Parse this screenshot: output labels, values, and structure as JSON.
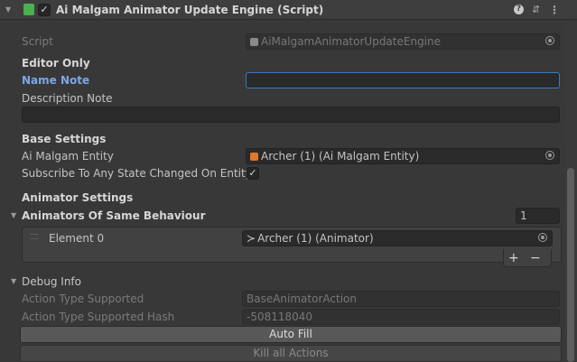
{
  "header": {
    "title": "Ai Malgam Animator Update Engine (Script)",
    "icons": [
      "foldout-triangle-icon",
      "script-icon",
      "checkbox-check-icon",
      "help-icon",
      "preset-icon",
      "kebab-menu-icon"
    ]
  },
  "script_row": {
    "label": "Script",
    "value": "AiMalgamAnimatorUpdateEngine"
  },
  "editor_only": {
    "heading": "Editor Only",
    "name_note_label": "Name Note",
    "name_note_value": "",
    "description_label": "Description Note",
    "description_value": ""
  },
  "base_settings": {
    "heading": "Base Settings",
    "entity_label": "Ai Malgam Entity",
    "entity_value": "Archer (1) (Ai Malgam Entity)",
    "subscribe_label": "Subscribe To Any State Changed On Entity",
    "subscribe_checked": "✓"
  },
  "animator_settings": {
    "heading": "Animator Settings",
    "list_label": "Animators Of Same Behaviour",
    "list_count": "1",
    "element_label": "Element 0",
    "element_value": "Archer (1) (Animator)",
    "add_label": "+",
    "remove_label": "−"
  },
  "debug": {
    "heading": "Debug Info",
    "action_type_label": "Action Type Supported",
    "action_type_value": "BaseAnimatorAction",
    "hash_label": "Action Type Supported Hash",
    "hash_value": "-508118040",
    "auto_fill_label": "Auto Fill",
    "kill_label": "Kill all Actions"
  },
  "colors": {
    "background": "#383838",
    "header": "#3e3e3e",
    "accent_label": "#7ca7e8",
    "focus_border": "#3a79bb",
    "entity_icon": "#e0792a"
  }
}
